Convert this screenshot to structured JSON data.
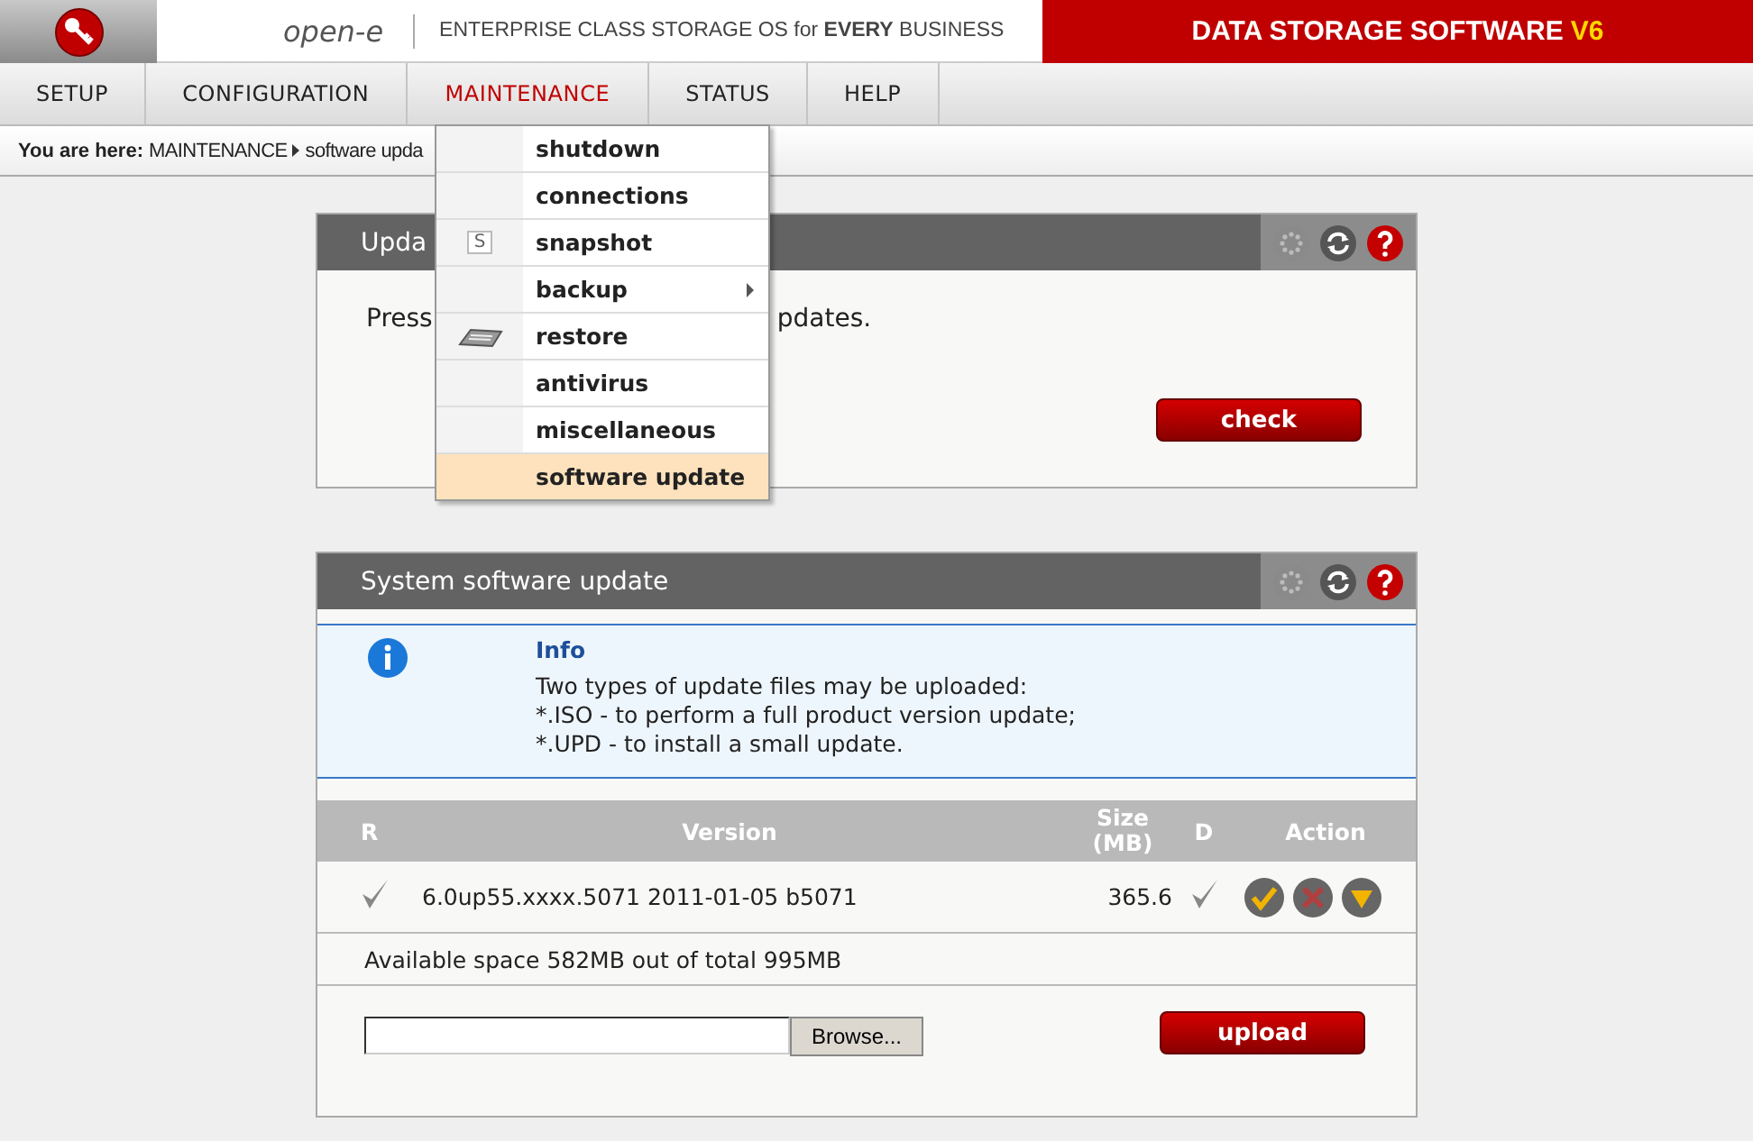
{
  "header": {
    "logo_text": "open-e",
    "tagline": "ENTERPRISE CLASS STORAGE OS for **EVERY** BUSINESS",
    "product": "DATA STORAGE SOFTWARE",
    "version": "V6"
  },
  "nav": [
    {
      "label": "SETUP",
      "selected": false
    },
    {
      "label": "CONFIGURATION",
      "selected": false
    },
    {
      "label": "MAINTENANCE",
      "selected": true
    },
    {
      "label": "STATUS",
      "selected": false
    },
    {
      "label": "HELP",
      "selected": false
    }
  ],
  "breadcrumb": {
    "prefix": "You are here:",
    "items": [
      "MAINTENANCE",
      "software upda"
    ]
  },
  "menu": [
    {
      "label": "shutdown",
      "selected": false
    },
    {
      "label": "connections",
      "selected": false
    },
    {
      "label": "snapshot",
      "selected": false,
      "kind": "letter",
      "icon_text": "S"
    },
    {
      "label": "backup",
      "selected": false,
      "submenu": true
    },
    {
      "label": "restore",
      "selected": false,
      "kind": "drive"
    },
    {
      "label": "antivirus",
      "selected": false
    },
    {
      "label": "miscellaneous",
      "selected": false
    },
    {
      "label": "software update",
      "selected": true
    }
  ],
  "update_panel": {
    "title": "Upda",
    "text_start": "Press",
    "text_end": "pdates.",
    "button": "check"
  },
  "system_panel": {
    "title": "System software update",
    "info": {
      "title": "Info",
      "lines": [
        "Two types of update files may be uploaded:",
        "*.ISO - to perform a full product version update;",
        "*.UPD - to install a small update."
      ]
    },
    "table": {
      "columns": [
        "R",
        "Version",
        "Size (MB)",
        "D",
        "Action"
      ],
      "rows": [
        {
          "r": true,
          "version": "6.0up55.xxxx.5071 2011-01-05 b5071",
          "size": "365.6",
          "d": true
        }
      ]
    },
    "space": "Available space 582MB out of total 995MB",
    "browse": "Browse...",
    "upload": "upload"
  }
}
